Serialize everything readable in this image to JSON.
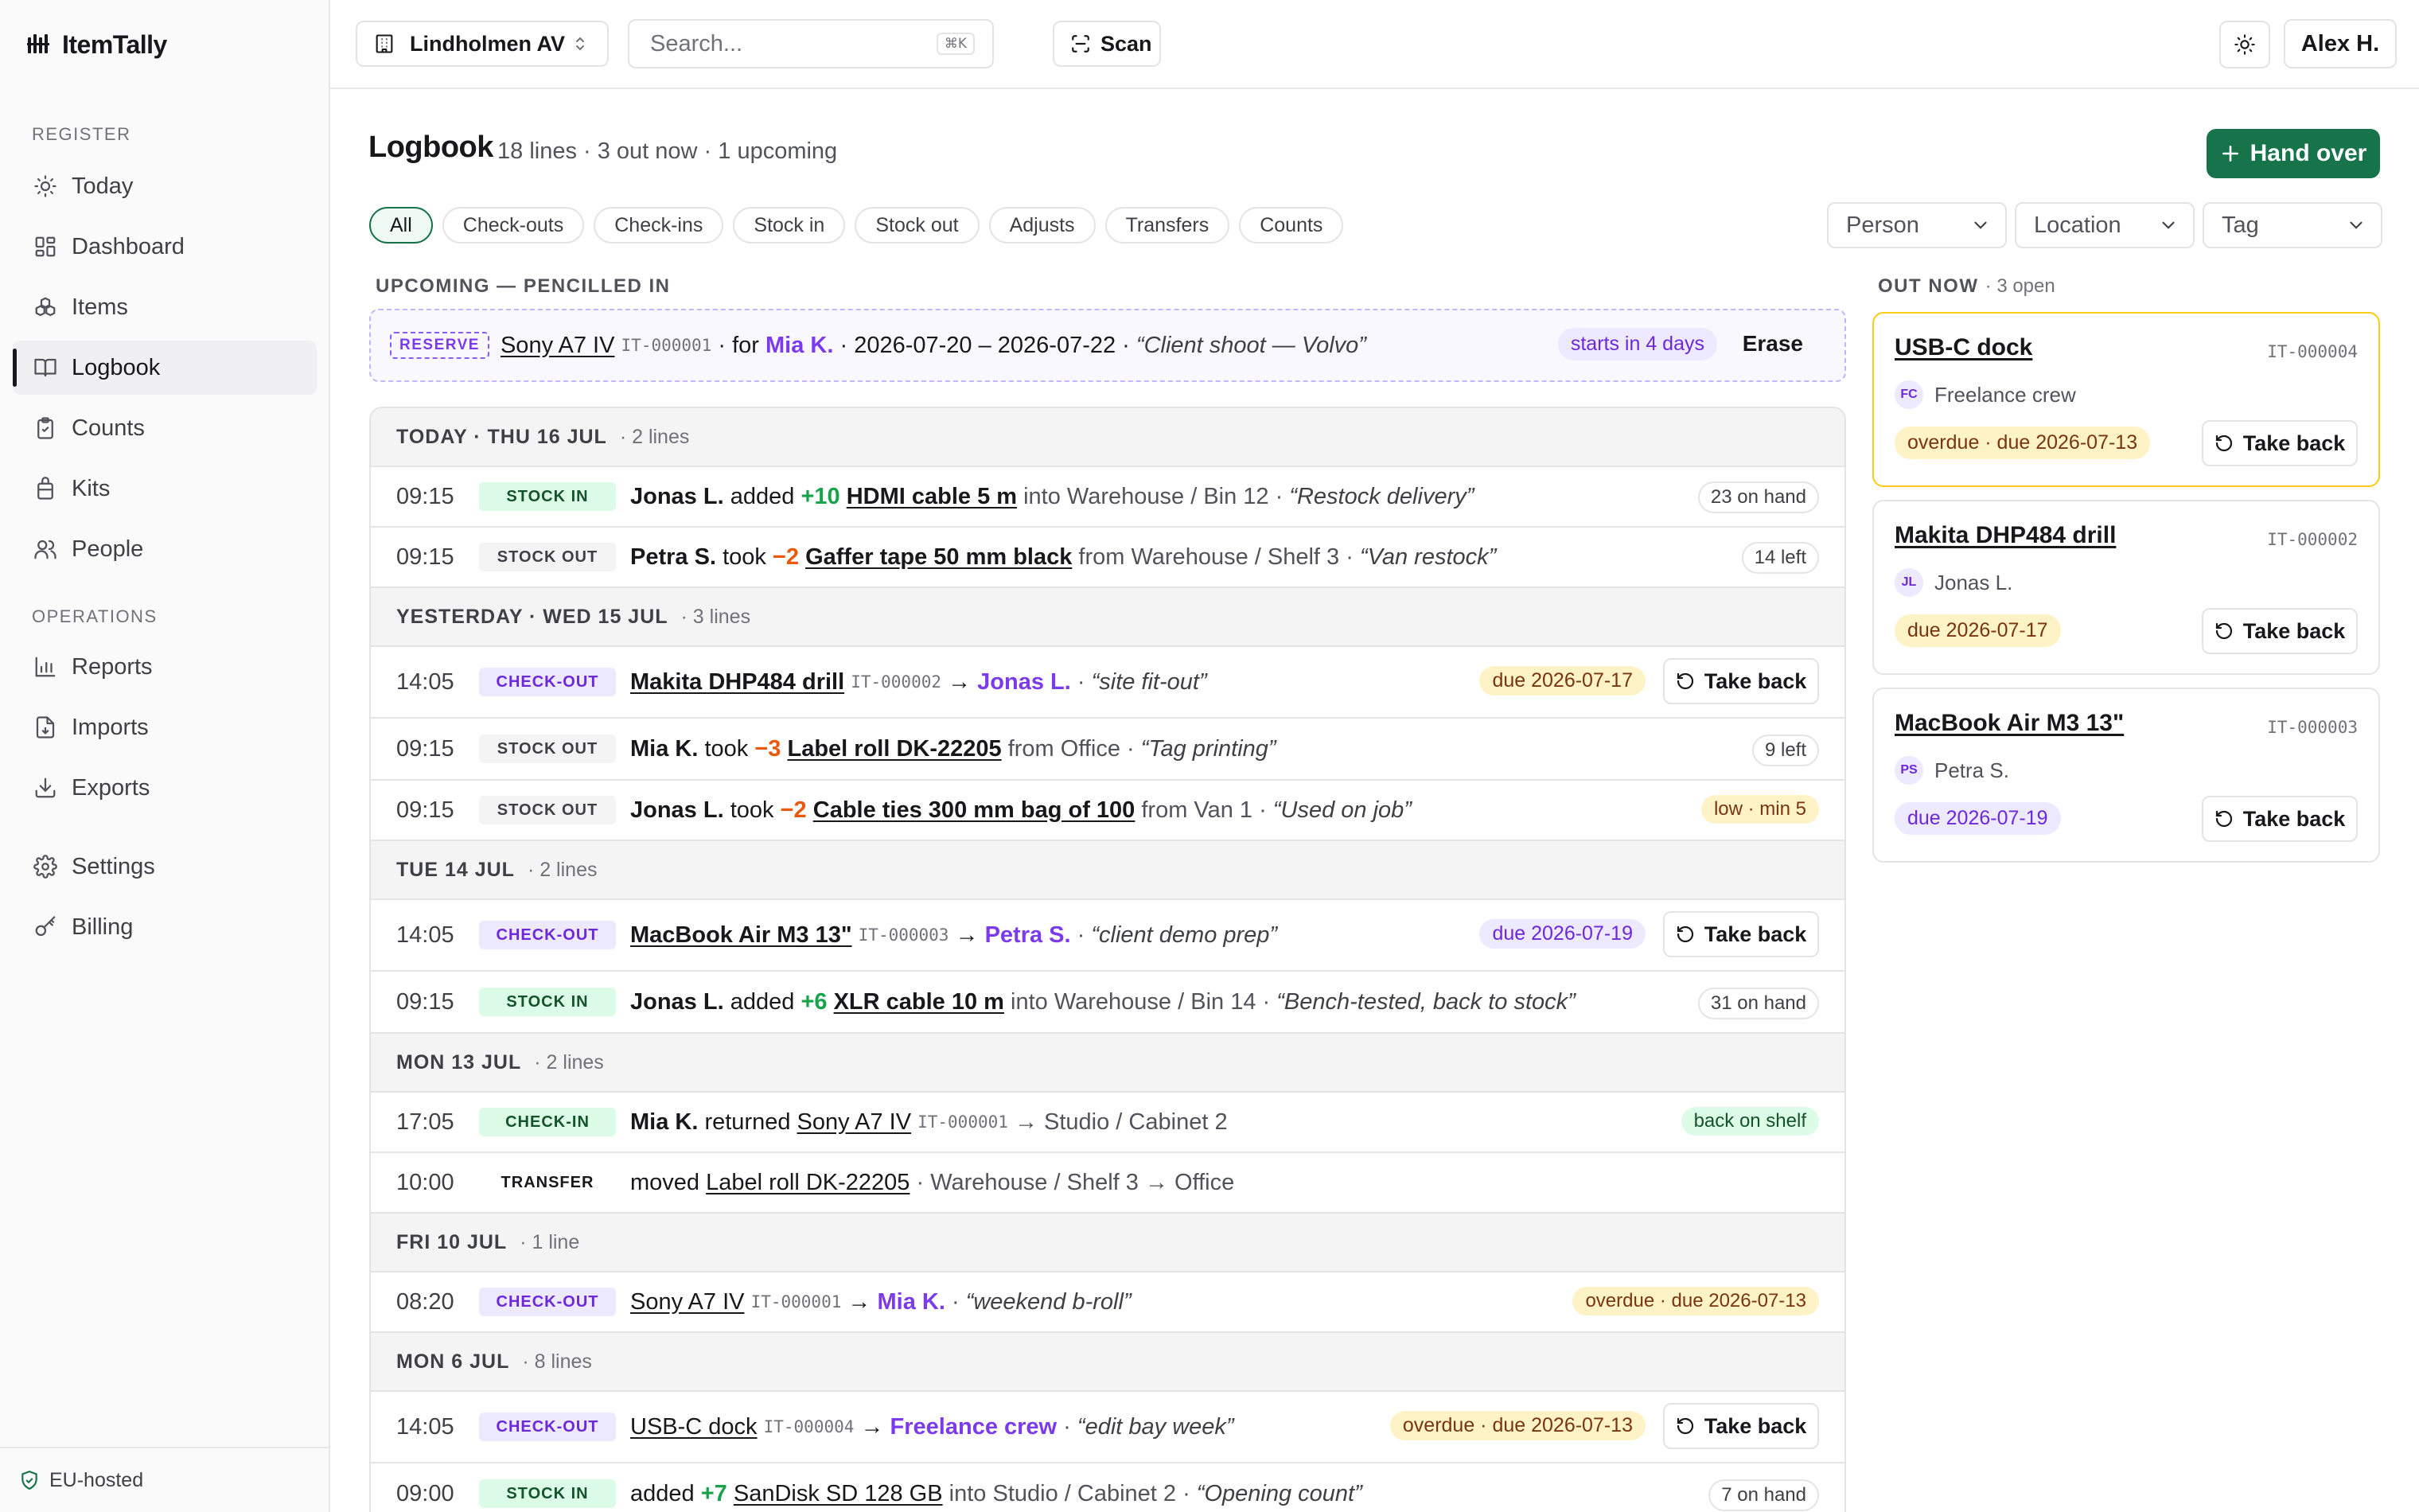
{
  "app": {
    "name": "ItemTally"
  },
  "sidebar": {
    "register_label": "REGISTER",
    "operations_label": "OPERATIONS",
    "items": [
      {
        "label": "Today",
        "icon": "sun-icon"
      },
      {
        "label": "Dashboard",
        "icon": "dashboard-icon"
      },
      {
        "label": "Items",
        "icon": "boxes-icon"
      },
      {
        "label": "Logbook",
        "icon": "book-icon",
        "active": true
      },
      {
        "label": "Counts",
        "icon": "clipboard-icon"
      },
      {
        "label": "Kits",
        "icon": "kit-icon"
      },
      {
        "label": "People",
        "icon": "users-icon"
      },
      {
        "label": "Reports",
        "icon": "bar-chart-icon"
      },
      {
        "label": "Imports",
        "icon": "file-import-icon"
      },
      {
        "label": "Exports",
        "icon": "download-icon"
      },
      {
        "label": "Settings",
        "icon": "gear-icon"
      },
      {
        "label": "Billing",
        "icon": "key-icon"
      }
    ],
    "footer": "EU-hosted"
  },
  "topbar": {
    "location": "Lindholmen AV",
    "search_placeholder": "Search...",
    "search_shortcut": "⌘K",
    "scan_label": "Scan",
    "user": "Alex H."
  },
  "page": {
    "title": "Logbook",
    "meta": "18 lines · 3 out now · 1 upcoming",
    "hand_over_label": "Hand over",
    "filters": [
      "All",
      "Check-outs",
      "Check-ins",
      "Stock in",
      "Stock out",
      "Adjusts",
      "Transfers",
      "Counts"
    ],
    "dropdowns": [
      "Person",
      "Location",
      "Tag"
    ]
  },
  "upcoming": {
    "label": "UPCOMING — PENCILLED IN",
    "tag": "RESERVE",
    "item": "Sony A7 IV",
    "id": "IT-000001",
    "for_text": "· for",
    "person": "Mia K.",
    "dates": "· 2026-07-20 – 2026-07-22 ·",
    "note": "“Client shoot — Volvo”",
    "status": "starts in 4 days",
    "erase_label": "Erase"
  },
  "log": {
    "days": [
      {
        "label": "TODAY · THU 16 JUL",
        "count": "· 2 lines"
      },
      {
        "label": "YESTERDAY · WED 15 JUL",
        "count": "· 3 lines"
      },
      {
        "label": "TUE 14 JUL",
        "count": "· 2 lines"
      },
      {
        "label": "MON 13 JUL",
        "count": "· 2 lines"
      },
      {
        "label": "FRI 10 JUL",
        "count": "· 1 line"
      },
      {
        "label": "MON 6 JUL",
        "count": "· 8 lines"
      }
    ],
    "rows": [
      {
        "time": "09:15",
        "type": "STOCK IN",
        "person": "Jonas L.",
        "verb": "added",
        "qty": "+10",
        "item": "HDMI cable 5 m",
        "where": "into Warehouse / Bin 12 ·",
        "note": "“Restock delivery”",
        "status": "23 on hand"
      },
      {
        "time": "09:15",
        "type": "STOCK OUT",
        "person": "Petra S.",
        "verb": "took",
        "qty": "−2",
        "item": "Gaffer tape 50 mm black",
        "where": "from Warehouse / Shelf 3 ·",
        "note": "“Van restock”",
        "status": "14 left"
      },
      {
        "time": "14:05",
        "type": "CHECK-OUT",
        "item": "Makita DHP484 drill",
        "id": "IT-000002",
        "arrow": "→",
        "person": "Jonas L.",
        "note": "“site fit-out”",
        "status": "due 2026-07-17",
        "action": "Take back"
      },
      {
        "time": "09:15",
        "type": "STOCK OUT",
        "person": "Mia K.",
        "verb": "took",
        "qty": "−3",
        "item": "Label roll DK-22205",
        "where": "from Office ·",
        "note": "“Tag printing”",
        "status": "9 left"
      },
      {
        "time": "09:15",
        "type": "STOCK OUT",
        "person": "Jonas L.",
        "verb": "took",
        "qty": "−2",
        "item": "Cable ties 300 mm bag of 100",
        "where": "from Van 1 ·",
        "note": "“Used on job”",
        "status": "low · min 5"
      },
      {
        "time": "14:05",
        "type": "CHECK-OUT",
        "item": "MacBook Air M3 13\"",
        "id": "IT-000003",
        "arrow": "→",
        "person": "Petra S.",
        "note": "“client demo prep”",
        "status": "due 2026-07-19",
        "action": "Take back"
      },
      {
        "time": "09:15",
        "type": "STOCK IN",
        "person": "Jonas L.",
        "verb": "added",
        "qty": "+6",
        "item": "XLR cable 10 m",
        "where": "into Warehouse / Bin 14 ·",
        "note": "“Bench-tested, back to stock”",
        "status": "31 on hand"
      },
      {
        "time": "17:05",
        "type": "CHECK-IN",
        "person": "Mia K.",
        "verb": "returned",
        "item": "Sony A7 IV",
        "id": "IT-000001",
        "where": "→ Studio / Cabinet 2",
        "status": "back on shelf"
      },
      {
        "time": "10:00",
        "type": "TRANSFER",
        "verb": "moved",
        "item": "Label roll DK-22205",
        "where": "· Warehouse / Shelf 3 → Office"
      },
      {
        "time": "08:20",
        "type": "CHECK-OUT",
        "item": "Sony A7 IV",
        "id": "IT-000001",
        "arrow": "→",
        "person": "Mia K.",
        "note": "“weekend b-roll”",
        "status": "overdue · due 2026-07-13"
      },
      {
        "time": "14:05",
        "type": "CHECK-OUT",
        "item": "USB-C dock",
        "id": "IT-000004",
        "arrow": "→",
        "person": "Freelance crew",
        "note": "“edit bay week”",
        "status": "overdue · due 2026-07-13",
        "action": "Take back"
      },
      {
        "time": "09:00",
        "type": "STOCK IN",
        "verb": "added",
        "qty": "+7",
        "item": "SanDisk SD 128 GB",
        "where": "into Studio / Cabinet 2 ·",
        "note": "“Opening count”",
        "status": "7 on hand"
      }
    ]
  },
  "out_now": {
    "label": "OUT NOW",
    "count": "· 3 open",
    "cards": [
      {
        "name": "USB-C dock",
        "id": "IT-000004",
        "initials": "FC",
        "person": "Freelance crew",
        "status": "overdue · due 2026-07-13",
        "action": "Take back"
      },
      {
        "name": "Makita DHP484 drill",
        "id": "IT-000002",
        "initials": "JL",
        "person": "Jonas L.",
        "status": "due 2026-07-17",
        "action": "Take back"
      },
      {
        "name": "MacBook Air M3 13\"",
        "id": "IT-000003",
        "initials": "PS",
        "person": "Petra S.",
        "status": "due 2026-07-19",
        "action": "Take back"
      }
    ]
  },
  "colors": {
    "accent": "#16734a",
    "purple": "#7c3aed",
    "amber": "#fef3c7",
    "green": "#dcfce7"
  }
}
